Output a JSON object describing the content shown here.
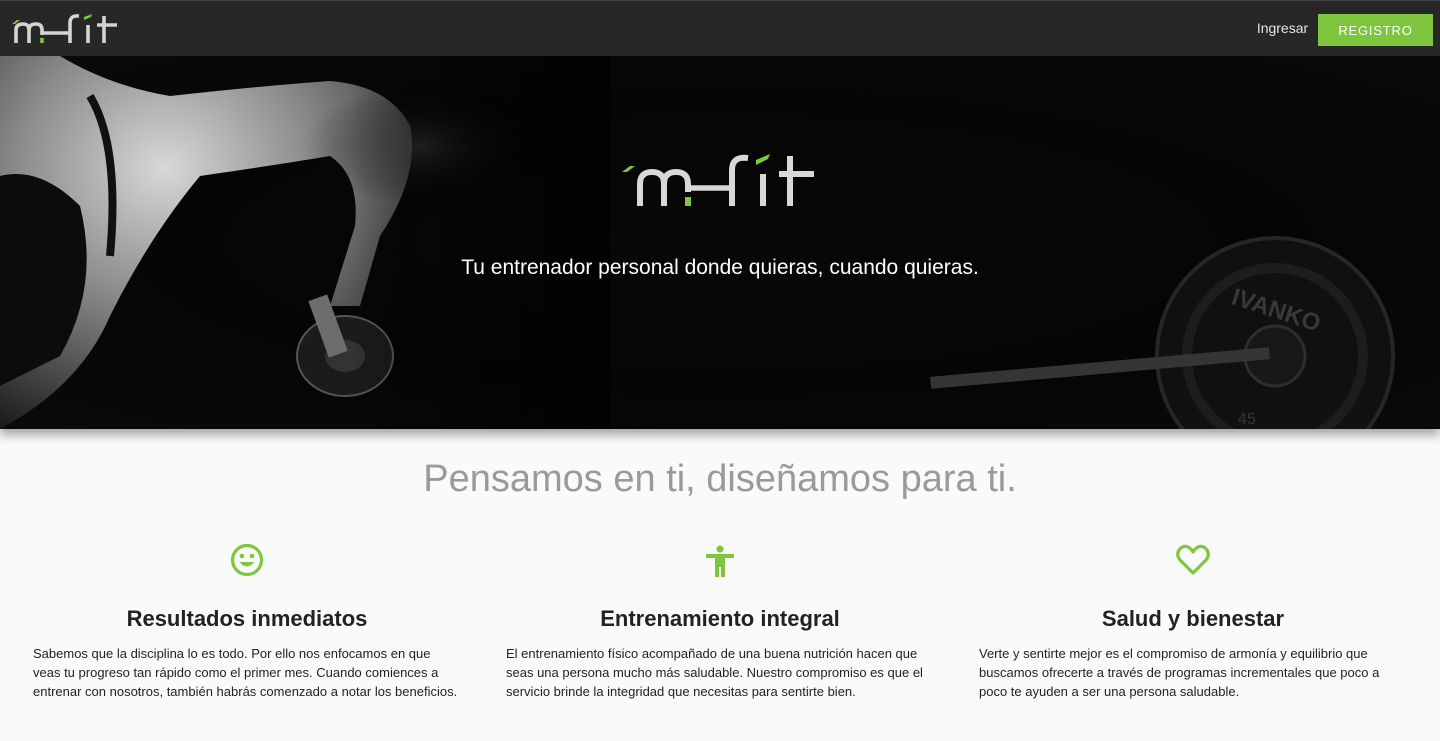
{
  "brand": {
    "logo_text": "m-fit",
    "accent_color": "#7dc63d"
  },
  "nav": {
    "login_label": "Ingresar",
    "register_label": "REGISTRO"
  },
  "hero": {
    "tagline": "Tu entrenador personal donde quieras, cuando quieras.",
    "plate_text": "IVANKO",
    "plate_weight": "45"
  },
  "main": {
    "title": "Pensamos en ti, diseñamos para ti.",
    "features": [
      {
        "icon": "smiley-icon",
        "title": "Resultados inmediatos",
        "text": "Sabemos que la disciplina lo es todo. Por ello nos enfocamos en que veas tu progreso tan rápido como el primer mes. Cuando comiences a entrenar con nosotros, también habrás comenzado a notar los beneficios."
      },
      {
        "icon": "person-icon",
        "title": "Entrenamiento integral",
        "text": "El entrenamiento físico acompañado de una buena nutrición hacen que seas una persona mucho más saludable. Nuestro compromiso es que el servicio brinde la integridad que necesitas para sentirte bien."
      },
      {
        "icon": "heart-icon",
        "title": "Salud y bienestar",
        "text": "Verte y sentirte mejor es el compromiso de armonía y equilibrio que buscamos ofrecerte a través de programas incrementales que poco a poco te ayuden a ser una persona saludable."
      }
    ]
  }
}
